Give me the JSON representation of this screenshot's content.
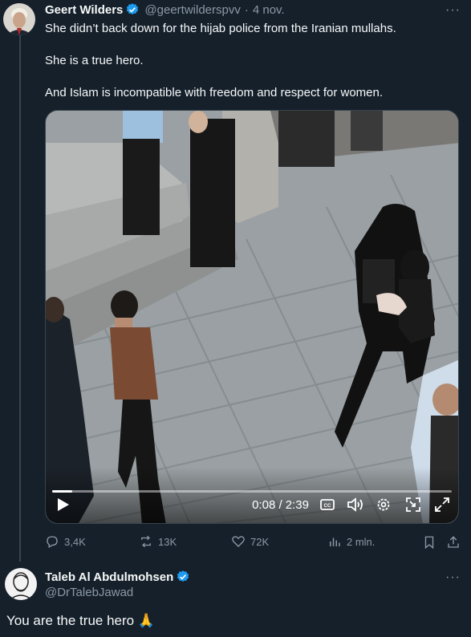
{
  "tweet": {
    "author_name": "Geert Wilders",
    "handle": "@geertwilderspvv",
    "separator": "·",
    "date": "4 nov.",
    "more_label": "···",
    "paragraphs": [
      "She didn’t back down for the hijab police from the Iranian mullahs.",
      "She is a true hero.",
      "And Islam is incompatible with freedom and respect for women."
    ],
    "video": {
      "current_time": "0:08",
      "duration": "2:39",
      "time_display": "0:08 / 2:39",
      "progress_fraction": 0.05,
      "controls": [
        "play-icon",
        "captions-icon",
        "volume-icon",
        "settings-icon",
        "pip-icon",
        "fullscreen-icon"
      ]
    },
    "stats": {
      "replies": "3,4K",
      "reposts": "13K",
      "likes": "72K",
      "views": "2 mln."
    }
  },
  "reply": {
    "author_name": "Taleb Al Abdulmohsen",
    "handle": "@DrTalebJawad",
    "more_label": "···",
    "text": "You are the true hero 🙏"
  },
  "colors": {
    "background": "#15202b",
    "text": "#f7f9f9",
    "muted": "#8b98a5",
    "verified": "#1d9bf0",
    "divider": "#38444d"
  }
}
